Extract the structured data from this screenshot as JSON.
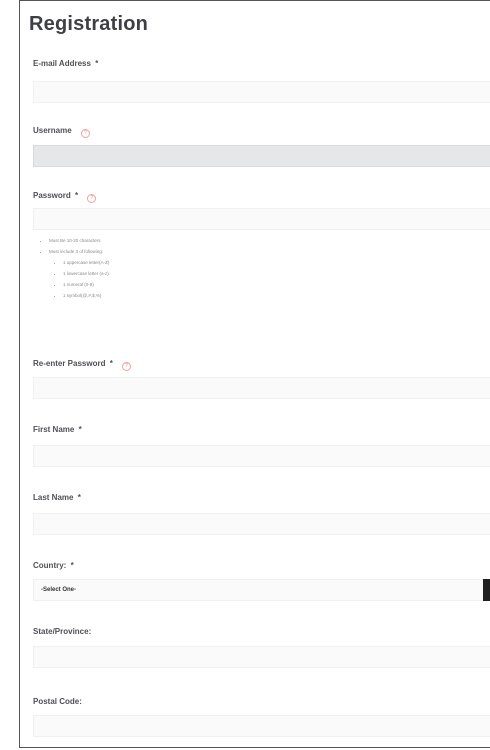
{
  "page": {
    "title": "Registration"
  },
  "fields": {
    "email": {
      "label": "E-mail Address",
      "required_mark": "*",
      "value": ""
    },
    "username": {
      "label": "Username",
      "value": ""
    },
    "password": {
      "label": "Password",
      "required_mark": "*",
      "value": ""
    },
    "reenter_password": {
      "label": "Re-enter Password",
      "required_mark": "*",
      "value": ""
    },
    "first_name": {
      "label": "First Name",
      "required_mark": "*",
      "value": ""
    },
    "last_name": {
      "label": "Last Name",
      "required_mark": "*",
      "value": ""
    },
    "country": {
      "label": "Country:",
      "required_mark": "*",
      "selected": "-Select One-"
    },
    "state": {
      "label": "State/Province:",
      "value": ""
    },
    "postal": {
      "label": "Postal Code:",
      "value": ""
    }
  },
  "password_rules": {
    "length": "Must Be 10-20 characters",
    "contain": "Must include 3 of following:",
    "sub": [
      "1 uppercase letter(A-Z)",
      "1 lowercase letter (a-z)",
      "1 numeral (0-9)",
      "1 symbol(@,#,$,%)"
    ]
  },
  "icons": {
    "info": "info-circle-icon",
    "dropdown": "caret-down-icon"
  },
  "colors": {
    "info_icon": "#f28080",
    "disabled_field": "#e6e7e8",
    "dropdown_button": "#1f1f1f"
  }
}
